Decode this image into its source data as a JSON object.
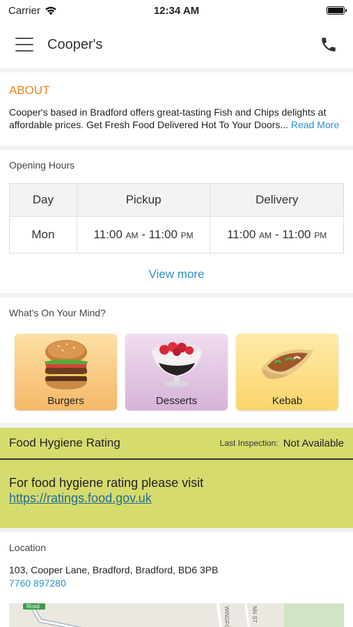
{
  "status_bar": {
    "carrier": "Carrier",
    "time": "12:34 AM"
  },
  "nav": {
    "title": "Cooper's"
  },
  "about": {
    "title": "ABOUT",
    "text": "Cooper's based in Bradford offers great-tasting Fish and Chips delights at affordable prices. Get Fresh Food Delivered Hot To Your Doors...",
    "read_more": "Read More"
  },
  "hours": {
    "label": "Opening Hours",
    "headers": [
      "Day",
      "Pickup",
      "Delivery"
    ],
    "rows": [
      {
        "day": "Mon",
        "pickup_open": "11:00",
        "pickup_open_ampm": "AM",
        "pickup_close": "11:00",
        "pickup_close_ampm": "PM",
        "delivery_open": "11:00",
        "delivery_open_ampm": "AM",
        "delivery_close": "11:00",
        "delivery_close_ampm": "PM"
      }
    ],
    "view_more": "View more"
  },
  "mind": {
    "label": "What's On Your Mind?",
    "tiles": [
      {
        "label": "Burgers"
      },
      {
        "label": "Desserts"
      },
      {
        "label": "Kebab"
      }
    ]
  },
  "hygiene": {
    "title": "Food Hygiene Rating",
    "last_inspection_label": "Last Inspection:",
    "last_inspection_value": "Not Available",
    "body_text": "For food hygiene rating please visit",
    "link": "https://ratings.food.gov.uk",
    "background_color": "#d6db6e"
  },
  "location": {
    "label": "Location",
    "address": "103, Cooper Lane, Bradford, Bradford, BD6 3PB",
    "phone": "7760 897280",
    "map_labels": [
      "Rosd",
      "WINGFORD",
      "NN ST"
    ]
  },
  "colors": {
    "accent_orange": "#e8861c",
    "link_blue": "#2f8fc7"
  }
}
